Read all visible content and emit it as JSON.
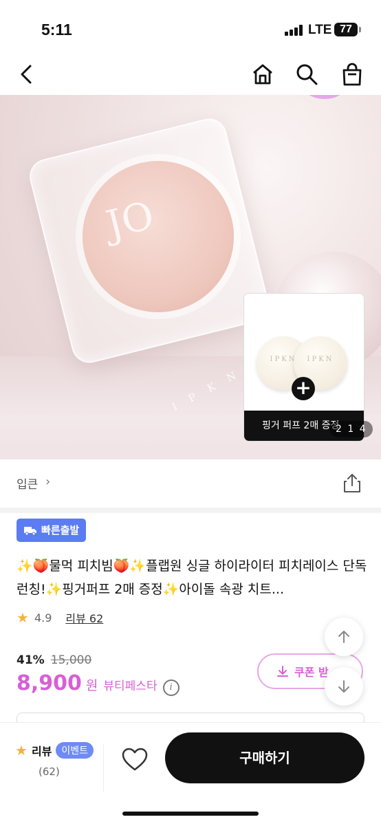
{
  "status_bar": {
    "time": "5:11",
    "network": "LTE",
    "battery": "77"
  },
  "nav": {
    "back_icon": "chevron-left-icon",
    "home_icon": "home-icon",
    "search_icon": "search-icon",
    "cart_icon": "shopping-bag-icon"
  },
  "hero": {
    "product_logo": "JO",
    "product_brand_text": "I P K N",
    "promo_label": "핑거 퍼프 2매 증정",
    "puff_text": "IPKN",
    "add_symbol": "+",
    "image_counter": "2 1 4"
  },
  "brand": {
    "name": "입큰",
    "chevron": "›"
  },
  "product": {
    "badge_label": "빠른출발",
    "title": "✨🍑물먹 피치빔🍑✨플랩원 싱글 하이라이터 피치레이스 단독 런칭!✨핑거퍼프 2매 증정✨아이돌 속광 치트...",
    "rating_score": "4.9",
    "reviews_label": "리뷰 62",
    "discount": "41%",
    "original_price": "15,000",
    "price": "8,900",
    "currency": "원",
    "event_label": "뷰티페스타",
    "info_symbol": "i",
    "coupon_label": "쿠폰 받"
  },
  "bottom_bar": {
    "review_label": "리뷰",
    "event_badge": "이벤트",
    "review_count": "(62)",
    "buy_label": "구매하기"
  },
  "colors": {
    "accent": "#d85fd6",
    "badge_blue": "#5b7cf2",
    "star": "#f2b33d",
    "buy_button": "#111111"
  }
}
